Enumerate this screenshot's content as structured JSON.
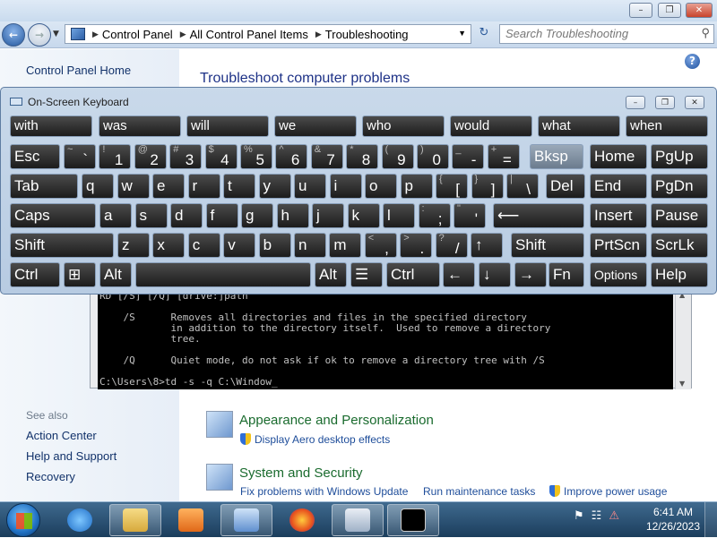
{
  "window": {
    "controls": {
      "minimize": "–",
      "maximize": "❐",
      "close": "✕"
    }
  },
  "address": {
    "crumbs": [
      "Control Panel",
      "All Control Panel Items",
      "Troubleshooting"
    ],
    "search_placeholder": "Search Troubleshooting"
  },
  "sidebar": {
    "home": "Control Panel Home",
    "see_also": "See also",
    "links": [
      "Action Center",
      "Help and Support",
      "Recovery"
    ]
  },
  "main": {
    "title": "Troubleshoot computer problems",
    "categories": [
      {
        "title": "Appearance and Personalization",
        "links": [
          "Display Aero desktop effects"
        ]
      },
      {
        "title": "System and Security",
        "links": [
          "Fix problems with Windows Update",
          "Run maintenance tasks",
          "Improve power usage"
        ]
      }
    ]
  },
  "console": {
    "lines": [
      "RD [/S] [/Q] [drive:]path",
      "",
      "    /S      Removes all directories and files in the specified directory",
      "            in addition to the directory itself.  Used to remove a directory",
      "            tree.",
      "",
      "    /Q      Quiet mode, do not ask if ok to remove a directory tree with /S",
      "",
      "C:\\Users\\8>td -s -q C:\\Window_"
    ]
  },
  "osk": {
    "title": "On-Screen Keyboard",
    "suggestions": [
      "with",
      "was",
      "will",
      "we",
      "who",
      "would",
      "what",
      "when"
    ],
    "row1": [
      {
        "label": "Esc"
      },
      {
        "sup": "~",
        "main": "`"
      },
      {
        "sup": "!",
        "main": "1"
      },
      {
        "sup": "@",
        "main": "2"
      },
      {
        "sup": "#",
        "main": "3"
      },
      {
        "sup": "$",
        "main": "4"
      },
      {
        "sup": "%",
        "main": "5"
      },
      {
        "sup": "^",
        "main": "6"
      },
      {
        "sup": "&",
        "main": "7"
      },
      {
        "sup": "*",
        "main": "8"
      },
      {
        "sup": "(",
        "main": "9"
      },
      {
        "sup": ")",
        "main": "0"
      },
      {
        "sup": "_",
        "main": "-"
      },
      {
        "sup": "+",
        "main": "="
      },
      {
        "label": "Bksp"
      },
      {
        "label": "Home"
      },
      {
        "label": "PgUp"
      }
    ],
    "row2": [
      {
        "label": "Tab"
      },
      {
        "label": "q"
      },
      {
        "label": "w"
      },
      {
        "label": "e"
      },
      {
        "label": "r"
      },
      {
        "label": "t"
      },
      {
        "label": "y"
      },
      {
        "label": "u"
      },
      {
        "label": "i"
      },
      {
        "label": "o"
      },
      {
        "label": "p"
      },
      {
        "sup": "{",
        "main": "["
      },
      {
        "sup": "}",
        "main": "]"
      },
      {
        "sup": "|",
        "main": "\\"
      },
      {
        "label": "Del"
      },
      {
        "label": "End"
      },
      {
        "label": "PgDn"
      }
    ],
    "row3": [
      {
        "label": "Caps"
      },
      {
        "label": "a"
      },
      {
        "label": "s"
      },
      {
        "label": "d"
      },
      {
        "label": "f"
      },
      {
        "label": "g"
      },
      {
        "label": "h"
      },
      {
        "label": "j"
      },
      {
        "label": "k"
      },
      {
        "label": "l"
      },
      {
        "sup": ":",
        "main": ";"
      },
      {
        "sup": "\"",
        "main": "'"
      },
      {
        "label": "⟵"
      },
      {
        "label": "Insert"
      },
      {
        "label": "Pause"
      }
    ],
    "row4": [
      {
        "label": "Shift"
      },
      {
        "label": "z"
      },
      {
        "label": "x"
      },
      {
        "label": "c"
      },
      {
        "label": "v"
      },
      {
        "label": "b"
      },
      {
        "label": "n"
      },
      {
        "label": "m"
      },
      {
        "sup": "<",
        "main": ","
      },
      {
        "sup": ">",
        "main": "."
      },
      {
        "sup": "?",
        "main": "/"
      },
      {
        "label": "↑"
      },
      {
        "label": "Shift"
      },
      {
        "label": "PrtScn"
      },
      {
        "label": "ScrLk"
      }
    ],
    "row5": [
      {
        "label": "Ctrl"
      },
      {
        "label": "⊞"
      },
      {
        "label": "Alt"
      },
      {
        "label": ""
      },
      {
        "label": "Alt"
      },
      {
        "label": "☰"
      },
      {
        "label": "Ctrl"
      },
      {
        "label": "←"
      },
      {
        "label": "↓"
      },
      {
        "label": "→"
      },
      {
        "label": "Fn"
      },
      {
        "label": "Options"
      },
      {
        "label": "Help"
      }
    ]
  },
  "taskbar": {
    "apps": [
      "internet-explorer",
      "windows-explorer",
      "media-player",
      "control-panel",
      "firefox",
      "on-screen-keyboard",
      "command-prompt"
    ],
    "tray_icons": [
      "⚑",
      "☷",
      "⚠"
    ],
    "time": "6:41 AM",
    "date": "12/26/2023"
  }
}
